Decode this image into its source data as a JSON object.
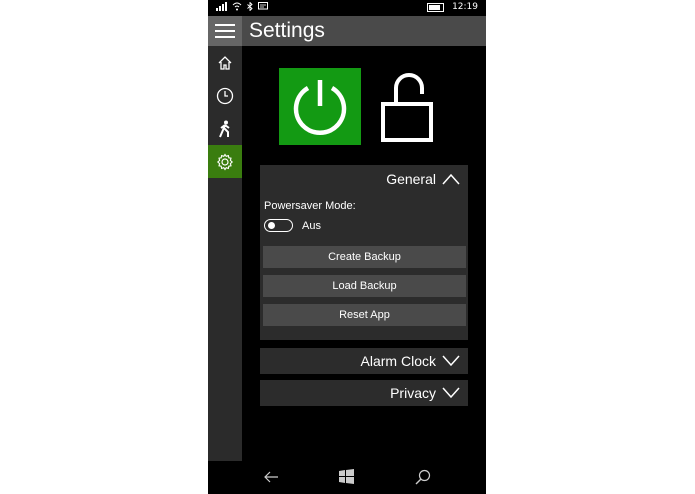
{
  "status": {
    "time": "12:19"
  },
  "header": {
    "title": "Settings"
  },
  "sidebar": {
    "items": [
      {
        "icon": "home-icon"
      },
      {
        "icon": "clock-icon"
      },
      {
        "icon": "walking-person-icon"
      },
      {
        "icon": "gear-icon",
        "active": true
      }
    ]
  },
  "tiles": {
    "power_icon": "power-icon",
    "lock_icon": "unlocked-padlock-icon"
  },
  "general": {
    "title": "General",
    "powersaver_label": "Powersaver Mode:",
    "toggle_state": "Aus",
    "buttons": [
      "Create Backup",
      "Load Backup",
      "Reset App"
    ]
  },
  "alarm": {
    "title": "Alarm Clock"
  },
  "privacy": {
    "title": "Privacy"
  },
  "colors": {
    "accent": "#139a13",
    "nav_active": "#3a7d0f",
    "panel": "#2c2c2c",
    "button": "#4a4a4a"
  }
}
